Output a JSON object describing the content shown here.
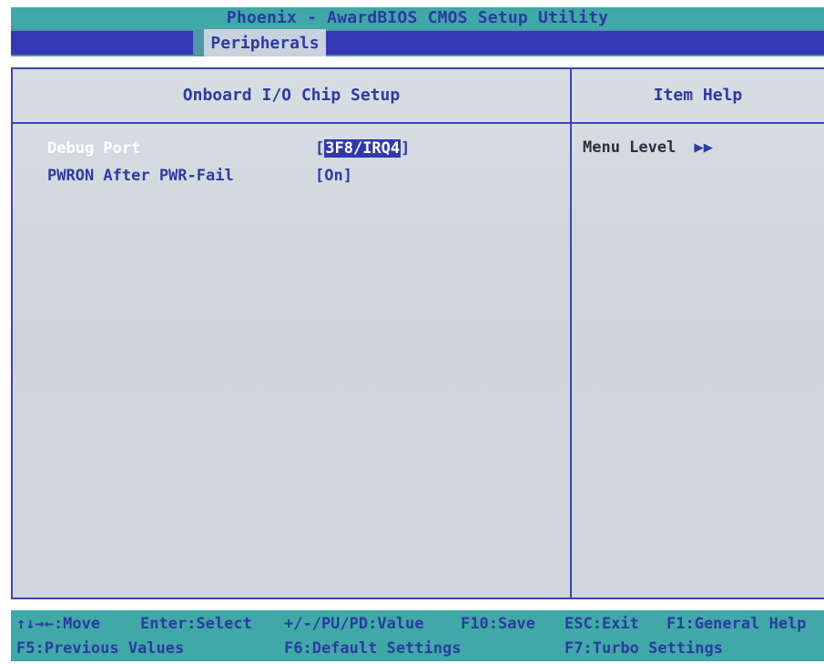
{
  "window": {
    "title": "Phoenix - AwardBIOS CMOS Setup Utility"
  },
  "menu": {
    "active_tab": "Peripherals"
  },
  "panel": {
    "section_title": "Onboard I/O Chip Setup",
    "help_title": "Item Help",
    "help_menu_level_label": "Menu Level",
    "help_menu_level_marker": "▶▶"
  },
  "settings": [
    {
      "label": "Debug Port",
      "value": "3F8/IRQ4",
      "bracket_open": "[",
      "bracket_close": "]",
      "selected": true
    },
    {
      "label": "PWRON After PWR-Fail",
      "value": "[On]",
      "selected": false
    }
  ],
  "footer": {
    "row1": {
      "move": "↑↓→←:Move",
      "select": "Enter:Select",
      "value": "+/-/PU/PD:Value",
      "save": "F10:Save",
      "exit": "ESC:Exit",
      "help": "F1:General Help"
    },
    "row2": {
      "prev": "F5:Previous Values",
      "default": "F6:Default Settings",
      "turbo": "F7:Turbo Settings"
    }
  },
  "colors": {
    "title_bar": "#41a8a8",
    "menu_blue": "#3438b4",
    "panel_bg": "#d6dee2",
    "text_blue": "#2e3aa6",
    "highlight": "#2f3ab1"
  }
}
